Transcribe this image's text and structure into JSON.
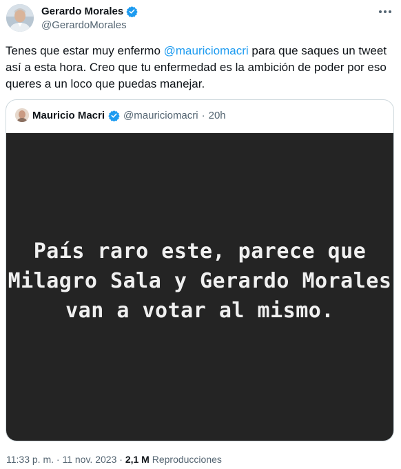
{
  "author": {
    "display_name": "Gerardo Morales",
    "handle": "@GerardoMorales"
  },
  "tweet": {
    "text_1": "Tenes que estar muy enfermo ",
    "mention": "@mauriciomacri",
    "text_2": " para que saques un tweet así a esta hora. Creo que tu enfermedad es la ambición de poder por eso queres a un loco que puedas manejar."
  },
  "quoted": {
    "display_name": "Mauricio Macri",
    "handle": "@mauriciomacri",
    "separator": "·",
    "time": "20h",
    "image_text": "País raro este, parece que Milagro Sala y Gerardo Morales van a votar al mismo."
  },
  "meta": {
    "time": "11:33 p. m.",
    "sep1": "·",
    "date": "11 nov. 2023",
    "sep2": "·",
    "views_count": "2,1 M",
    "views_label": "Reproducciones"
  },
  "icons": {
    "verified": "verified-badge-icon",
    "more": "more-options-icon"
  },
  "colors": {
    "link": "#1d9bf0",
    "verified": "#1d9bf0",
    "secondary_text": "#536471",
    "image_bg": "#242424"
  }
}
